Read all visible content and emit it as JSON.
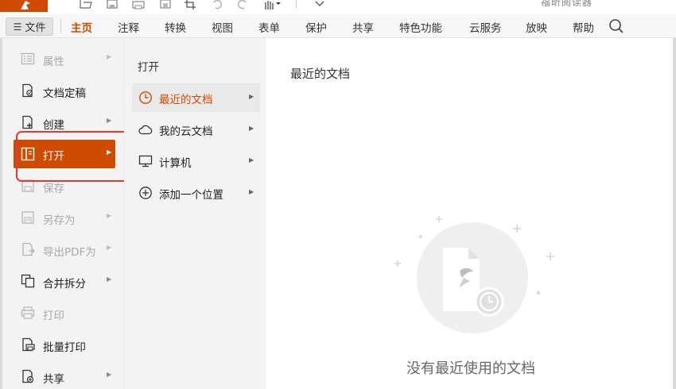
{
  "app": {
    "title": "福昕阅读器",
    "brand_color": "#cf4b00",
    "quick_access_icons": [
      "open-folder-icon",
      "save-icon",
      "print-icon",
      "print-preview-icon",
      "crop-icon",
      "undo-icon",
      "redo-icon",
      "hand-tool-icon",
      "dropdown-icon"
    ]
  },
  "ribbon": {
    "file_button": "文件",
    "tabs": [
      {
        "label": "主页",
        "active": true
      },
      {
        "label": "注释",
        "active": false
      },
      {
        "label": "转换",
        "active": false
      },
      {
        "label": "视图",
        "active": false
      },
      {
        "label": "表单",
        "active": false
      },
      {
        "label": "保护",
        "active": false
      },
      {
        "label": "共享",
        "active": false
      },
      {
        "label": "特色功能",
        "active": false
      },
      {
        "label": "云服务",
        "active": false
      },
      {
        "label": "放映",
        "active": false
      },
      {
        "label": "帮助",
        "active": false
      }
    ],
    "search_icon": "search-icon"
  },
  "file_menu": {
    "items": [
      {
        "label": "属性",
        "icon": "properties-icon",
        "disabled": true,
        "submenu": true
      },
      {
        "label": "文档定稿",
        "icon": "finalize-document-icon",
        "disabled": false,
        "submenu": false
      },
      {
        "label": "创建",
        "icon": "create-icon",
        "disabled": false,
        "submenu": true
      },
      {
        "label": "打开",
        "icon": "open-icon",
        "disabled": false,
        "submenu": true,
        "selected": true
      },
      {
        "label": "保存",
        "icon": "save-icon",
        "disabled": true,
        "submenu": false
      },
      {
        "label": "另存为",
        "icon": "save-as-icon",
        "disabled": true,
        "submenu": true
      },
      {
        "label": "导出PDF为",
        "icon": "export-pdf-icon",
        "disabled": true,
        "submenu": true
      },
      {
        "label": "合并拆分",
        "icon": "merge-split-icon",
        "disabled": false,
        "submenu": true
      },
      {
        "label": "打印",
        "icon": "print-icon",
        "disabled": true,
        "submenu": false
      },
      {
        "label": "批量打印",
        "icon": "batch-print-icon",
        "disabled": false,
        "submenu": false
      },
      {
        "label": "共享",
        "icon": "share-icon",
        "disabled": false,
        "submenu": true
      }
    ]
  },
  "open_submenu": {
    "title": "打开",
    "items": [
      {
        "label": "最近的文档",
        "icon": "clock-icon",
        "selected": true
      },
      {
        "label": "我的云文档",
        "icon": "cloud-icon",
        "selected": false
      },
      {
        "label": "计算机",
        "icon": "computer-icon",
        "selected": false
      },
      {
        "label": "添加一个位置",
        "icon": "add-location-icon",
        "selected": false
      }
    ]
  },
  "recent": {
    "title": "最近的文档",
    "empty_message": "没有最近使用的文档"
  }
}
